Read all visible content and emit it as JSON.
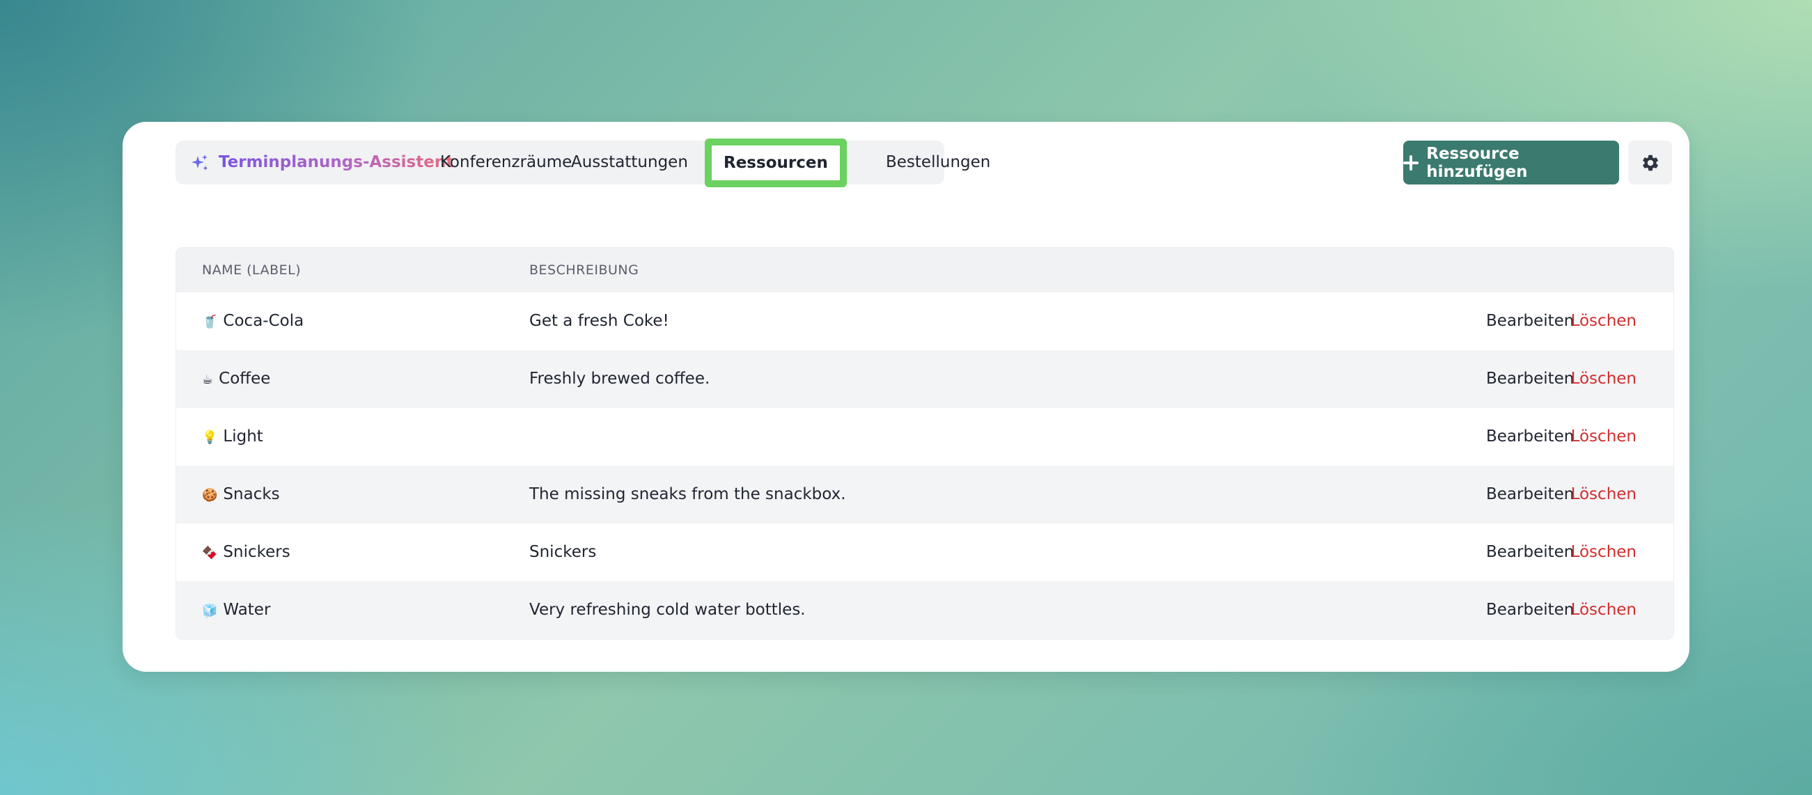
{
  "tabs": {
    "assistant_label": "Terminplanungs-Assistent",
    "conference_rooms_label": "Konferenzräume",
    "equipment_label": "Ausstattungen",
    "resources_label": "Ressourcen",
    "orders_label": "Bestellungen",
    "active": "Ressourcen"
  },
  "toolbar": {
    "add_resource_label": "Ressource hinzufügen"
  },
  "table": {
    "headers": {
      "name": "NAME (LABEL)",
      "description": "BESCHREIBUNG"
    },
    "rows": [
      {
        "emoji": "🥤",
        "name": "Coca-Cola",
        "description": "Get a fresh Coke!",
        "edit": "Bearbeiten",
        "delete": "Löschen"
      },
      {
        "emoji": "☕",
        "name": "Coffee",
        "description": "Freshly brewed coffee.",
        "edit": "Bearbeiten",
        "delete": "Löschen"
      },
      {
        "emoji": "💡",
        "name": "Light",
        "description": "",
        "edit": "Bearbeiten",
        "delete": "Löschen"
      },
      {
        "emoji": "🍪",
        "name": "Snacks",
        "description": "The missing sneaks from the snackbox.",
        "edit": "Bearbeiten",
        "delete": "Löschen"
      },
      {
        "emoji": "🍫",
        "name": "Snickers",
        "description": "Snickers",
        "edit": "Bearbeiten",
        "delete": "Löschen"
      },
      {
        "emoji": "🧊",
        "name": "Water",
        "description": "Very refreshing cold water bottles.",
        "edit": "Bearbeiten",
        "delete": "Löschen"
      }
    ]
  },
  "colors": {
    "accent": "#3b7a6e",
    "active_tab_highlight": "#6bd160",
    "delete_red": "#d22e2e"
  },
  "icons": {
    "assistant": "sparkle-icon",
    "add": "plus-icon",
    "settings": "gear-icon"
  }
}
